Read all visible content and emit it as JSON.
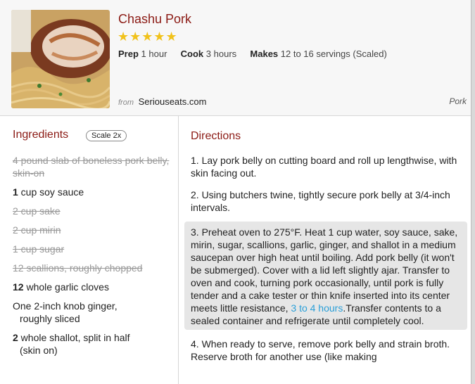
{
  "recipe": {
    "title": "Chashu Pork",
    "stars": "★★★★★",
    "prep_label": "Prep",
    "prep_value": "1 hour",
    "cook_label": "Cook",
    "cook_value": "3 hours",
    "makes_label": "Makes",
    "makes_value": "12 to 16 servings (Scaled)",
    "source_prefix": "from",
    "source_name": "Seriouseats.com",
    "category": "Pork"
  },
  "ingredients": {
    "heading": "Ingredients",
    "scale_label": "Scale 2x",
    "items": [
      {
        "qty": "4",
        "text": " pound slab of boneless pork belly, skin-on",
        "struck": true
      },
      {
        "qty": "1",
        "text": " cup soy sauce",
        "struck": false
      },
      {
        "qty": "2",
        "text": " cup sake",
        "struck": true
      },
      {
        "qty": "2",
        "text": " cup mirin",
        "struck": true
      },
      {
        "qty": "1",
        "text": " cup sugar",
        "struck": true
      },
      {
        "qty": "12",
        "text": " scallions, roughly chopped",
        "struck": true
      },
      {
        "qty": "12",
        "text": " whole garlic cloves",
        "struck": false
      },
      {
        "qty": "",
        "line1": "One 2-inch knob ginger,",
        "line2": "roughly sliced",
        "struck": false
      },
      {
        "qty": "2",
        "line1": " whole shallot, split in half",
        "line2": "(skin on)",
        "struck": false
      }
    ]
  },
  "directions": {
    "heading": "Directions",
    "steps": [
      {
        "text": "1. Lay pork belly on cutting board and roll up lengthwise, with skin facing out."
      },
      {
        "text": "2. Using butchers twine, tightly secure pork belly at 3/4-inch intervals."
      },
      {
        "text_before": "3. Preheat oven to 275°F. Heat 1 cup water, soy sauce, sake, mirin, sugar, scallions, garlic, ginger, and shallot in a medium saucepan over high heat until boiling. Add pork belly (it won't be submerged). Cover with a lid left slightly ajar. Transfer to oven and cook, turning pork occasionally, until pork is fully tender and a cake tester or thin knife inserted into its center meets little resistance, ",
        "time_link": "3 to 4 hours",
        "text_after": ".Transfer contents to a sealed container and refrigerate until completely cool."
      },
      {
        "text": "4. When ready to serve, remove pork belly and strain broth. Reserve broth for another use (like making"
      }
    ]
  },
  "colors": {
    "accent_red": "#8b1a14",
    "star_gold": "#f1c21b",
    "link_blue": "#2a9fd8",
    "active_step_bg": "#e6e6e6"
  }
}
